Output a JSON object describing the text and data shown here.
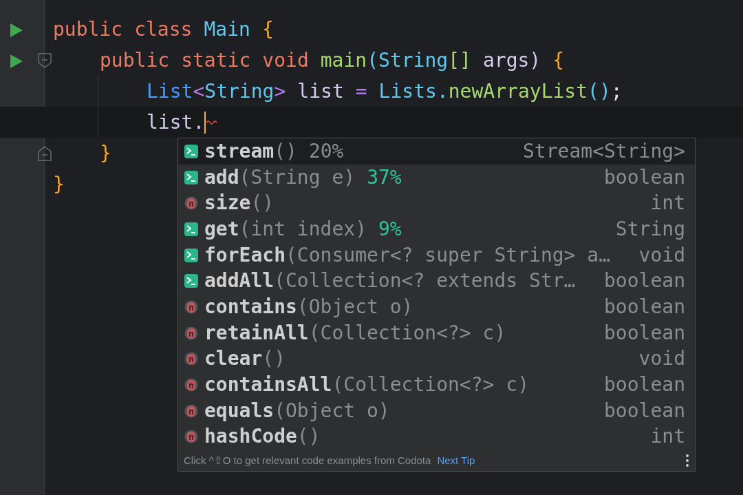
{
  "editor": {
    "lines": [
      {
        "run": true,
        "fold_start": false,
        "fold_end": false,
        "current": false,
        "caret": false,
        "words": [
          [
            {
              "kind": "keyword",
              "text": "public"
            }
          ],
          [
            {
              "kind": "keyword",
              "text": "class"
            }
          ],
          [
            {
              "kind": "type",
              "text": "Main"
            }
          ],
          [
            {
              "kind": "brace",
              "text": "{"
            }
          ]
        ],
        "children": [
          {
            "run": true,
            "fold_start": true,
            "fold_end": false,
            "current": false,
            "caret": false,
            "words": [
              [
                {
                  "kind": "keyword",
                  "text": "public"
                }
              ],
              [
                {
                  "kind": "keyword",
                  "text": "static"
                }
              ],
              [
                {
                  "kind": "keyword",
                  "text": "void"
                }
              ],
              [
                {
                  "kind": "method",
                  "text": "main"
                },
                {
                  "kind": "type",
                  "text": "(String"
                },
                {
                  "kind": "method",
                  "text": "[]"
                }
              ],
              [
                {
                  "kind": "plain",
                  "text": "args)"
                }
              ],
              [
                {
                  "kind": "brace",
                  "text": "{"
                }
              ]
            ],
            "children": [
              {
                "run": false,
                "fold_start": false,
                "fold_end": false,
                "current": false,
                "caret": false,
                "words": [
                  [
                    {
                      "kind": "interface",
                      "text": "List"
                    },
                    {
                      "kind": "operator",
                      "text": "<"
                    },
                    {
                      "kind": "type",
                      "text": "String"
                    },
                    {
                      "kind": "operator",
                      "text": ">"
                    }
                  ],
                  [
                    {
                      "kind": "plain",
                      "text": "list"
                    }
                  ],
                  [
                    {
                      "kind": "operator",
                      "text": "="
                    }
                  ],
                  [
                    {
                      "kind": "type",
                      "text": "Lists."
                    },
                    {
                      "kind": "method",
                      "text": "newArrayList"
                    },
                    {
                      "kind": "type",
                      "text": "()"
                    },
                    {
                      "kind": "punct",
                      "text": ";"
                    }
                  ]
                ]
              },
              {
                "run": false,
                "fold_start": false,
                "fold_end": false,
                "current": true,
                "caret": true,
                "words": [
                  [
                    {
                      "kind": "plain",
                      "text": "list."
                    }
                  ]
                ]
              }
            ]
          },
          {
            "run": false,
            "fold_start": false,
            "fold_end": true,
            "current": false,
            "caret": false,
            "words": [
              [
                {
                  "kind": "brace",
                  "text": "}"
                }
              ]
            ]
          }
        ]
      },
      {
        "run": false,
        "fold_start": false,
        "fold_end": false,
        "current": false,
        "caret": false,
        "words": [
          [
            {
              "kind": "brace",
              "text": "}"
            }
          ]
        ]
      }
    ]
  },
  "completion": {
    "items": [
      {
        "kind": "suggested",
        "name": "stream",
        "params": "()",
        "percent": "20%",
        "type": "Stream<String>",
        "selected": true
      },
      {
        "kind": "suggested",
        "name": "add",
        "params": "(String e)",
        "percent": "37%",
        "type": "boolean",
        "selected": false
      },
      {
        "kind": "method",
        "name": "size",
        "params": "()",
        "type": "int",
        "selected": false
      },
      {
        "kind": "suggested",
        "name": "get",
        "params": "(int index)",
        "percent": "9%",
        "type": "String",
        "selected": false
      },
      {
        "kind": "suggested",
        "name": "forEach",
        "params": "(Consumer<? super String> a…",
        "type": "void",
        "selected": false
      },
      {
        "kind": "suggested",
        "name": "addAll",
        "params": "(Collection<? extends Str…",
        "type": "boolean",
        "selected": false
      },
      {
        "kind": "method",
        "name": "contains",
        "params": "(Object o)",
        "type": "boolean",
        "selected": false
      },
      {
        "kind": "method",
        "name": "retainAll",
        "params": "(Collection<?> c)",
        "type": "boolean",
        "selected": false
      },
      {
        "kind": "method",
        "name": "clear",
        "params": "()",
        "type": "void",
        "selected": false
      },
      {
        "kind": "method",
        "name": "containsAll",
        "params": "(Collection<?> c)",
        "type": "boolean",
        "selected": false
      },
      {
        "kind": "method",
        "name": "equals",
        "params": "(Object o)",
        "type": "boolean",
        "selected": false
      },
      {
        "kind": "method",
        "name": "hashCode",
        "params": "()",
        "type": "int",
        "selected": false
      }
    ],
    "footer": {
      "hint": "Click ^⇧O to get relevant code examples from Codota",
      "link": "Next Tip"
    }
  }
}
